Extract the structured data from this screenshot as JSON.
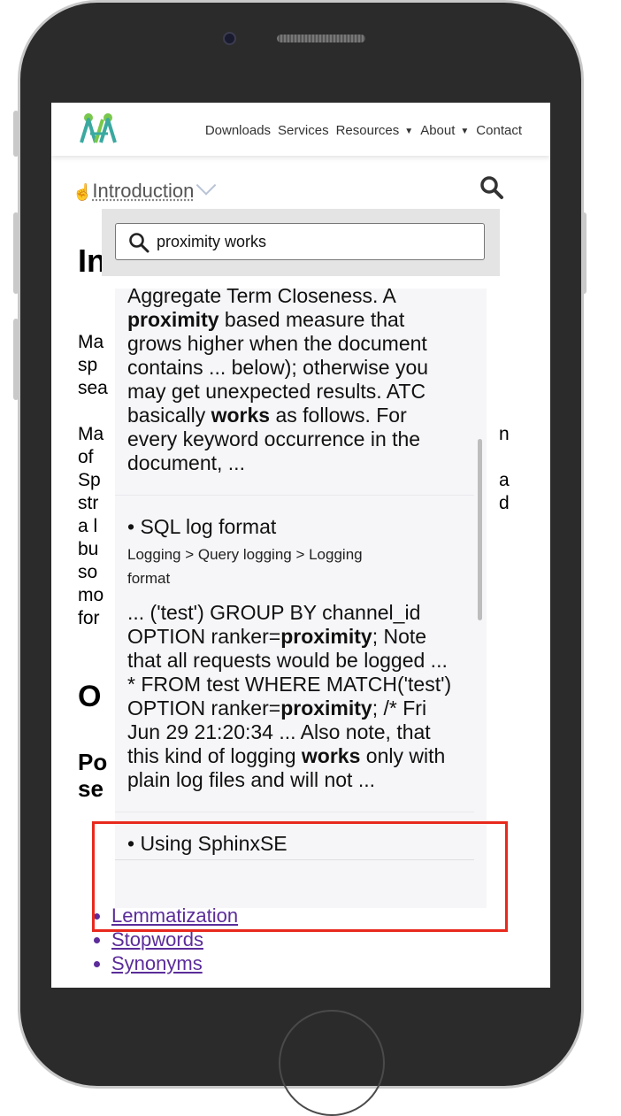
{
  "nav": {
    "items": [
      "Downloads",
      "Services",
      "Resources",
      "About",
      "Contact"
    ],
    "dropdowns": [
      false,
      false,
      true,
      true,
      false
    ]
  },
  "toc": {
    "hand": "☝",
    "label": "Introduction"
  },
  "page": {
    "heading_fragment": "In",
    "para1": [
      "Ma",
      "sp",
      "sea"
    ],
    "para2": [
      "Ma",
      "of",
      "Sp",
      "str",
      "a l",
      "bu",
      "so",
      "mo",
      "for"
    ],
    "para2_right": [
      "n",
      "",
      "a",
      "d"
    ],
    "heading2_fragment": "O",
    "heading3_fragment": [
      "Po",
      "se"
    ],
    "links": [
      "Lemmatization",
      "Stopwords",
      "Synonyms"
    ]
  },
  "search": {
    "value": "proximity works"
  },
  "results": [
    {
      "body": [
        [
          {
            "t": "Aggregate Term Closeness. A",
            "b": false
          }
        ],
        [
          {
            "t": "proximity",
            "b": true
          },
          {
            "t": " based measure that",
            "b": false
          }
        ],
        [
          {
            "t": "grows higher when the document",
            "b": false
          }
        ],
        [
          {
            "t": "contains ... below); otherwise you",
            "b": false
          }
        ],
        [
          {
            "t": "may get unexpected results. ATC",
            "b": false
          }
        ],
        [
          {
            "t": "basically ",
            "b": false
          },
          {
            "t": "works",
            "b": true
          },
          {
            "t": " as follows. For",
            "b": false
          }
        ],
        [
          {
            "t": "every keyword occurrence in the",
            "b": false
          }
        ],
        [
          {
            "t": "document, ...",
            "b": false
          }
        ]
      ]
    },
    {
      "title": "• SQL log format",
      "crumb": [
        "Logging > Query logging > Logging",
        "format"
      ],
      "body": [
        [
          {
            "t": "... ('test') GROUP BY channel_id",
            "b": false
          }
        ],
        [
          {
            "t": "OPTION ranker=",
            "b": false
          },
          {
            "t": "proximity",
            "b": true
          },
          {
            "t": "; Note",
            "b": false
          }
        ],
        [
          {
            "t": "that all requests would be logged ...",
            "b": false
          }
        ],
        [
          {
            "t": "* FROM test WHERE MATCH('test')",
            "b": false
          }
        ],
        [
          {
            "t": "OPTION ranker=",
            "b": false
          },
          {
            "t": "proximity",
            "b": true
          },
          {
            "t": "; /* Fri",
            "b": false
          }
        ],
        [
          {
            "t": "Jun 29 21:20:34 ... Also note, that",
            "b": false
          }
        ],
        [
          {
            "t": "this kind of logging ",
            "b": false
          },
          {
            "t": "works",
            "b": true
          },
          {
            "t": " only with",
            "b": false
          }
        ],
        [
          {
            "t": "plain log files and will not ...",
            "b": false
          }
        ]
      ]
    },
    {
      "title": "• Using SphinxSE"
    }
  ],
  "colors": {
    "highlight": "#e8291d",
    "link": "#5b2c9a",
    "panel": "#e4e4e4",
    "results_bg": "#f6f6f8"
  }
}
